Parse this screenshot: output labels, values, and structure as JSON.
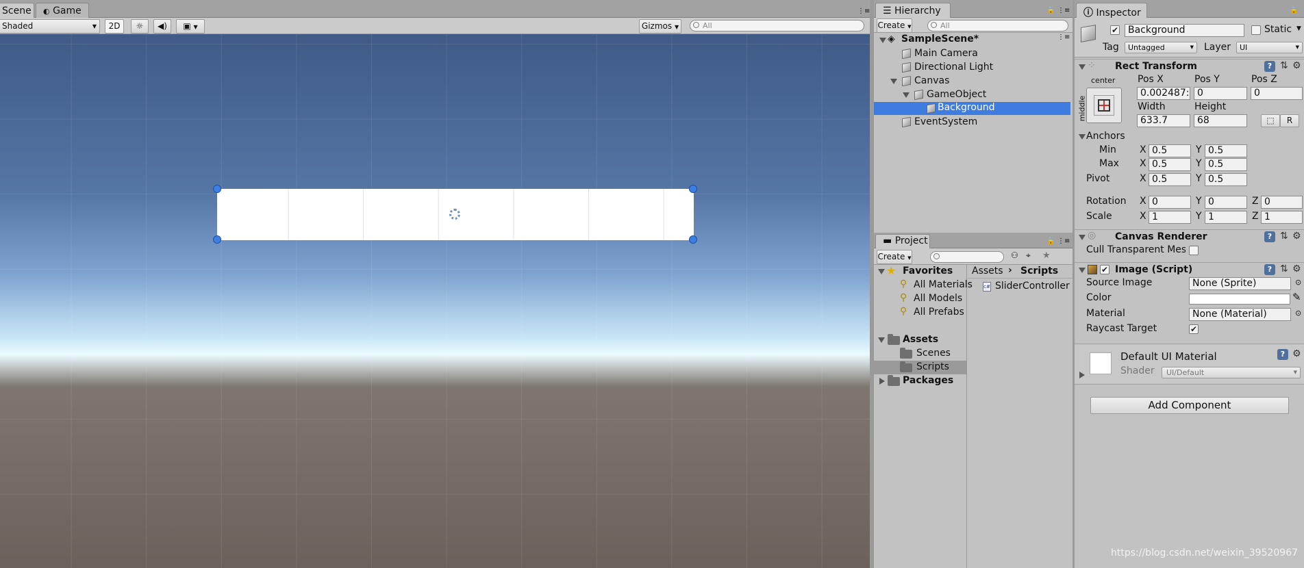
{
  "scene_view": {
    "tabs": [
      {
        "label": "Scene"
      },
      {
        "label": "Game"
      }
    ],
    "shading_mode": "Shaded",
    "mode_2d": "2D",
    "gizmos_label": "Gizmos",
    "search_placeholder": "All",
    "sky_color_top": "#3f5b86",
    "ground_color": "#6c625b"
  },
  "hierarchy": {
    "tab_label": "Hierarchy",
    "create_label": "Create",
    "search_placeholder": "All",
    "scene_name": "SampleScene*",
    "items": [
      {
        "label": "Main Camera"
      },
      {
        "label": "Directional Light"
      },
      {
        "label": "Canvas"
      },
      {
        "label": "GameObject"
      },
      {
        "label": "Background",
        "selected": true
      },
      {
        "label": "EventSystem"
      }
    ]
  },
  "project": {
    "tab_label": "Project",
    "create_label": "Create",
    "favorites_label": "Favorites",
    "favorites": [
      {
        "label": "All Materials"
      },
      {
        "label": "All Models"
      },
      {
        "label": "All Prefabs"
      }
    ],
    "assets_label": "Assets",
    "asset_folders": [
      {
        "label": "Scenes"
      },
      {
        "label": "Scripts",
        "selected": true
      }
    ],
    "packages_label": "Packages",
    "breadcrumb": [
      "Assets",
      "Scripts"
    ],
    "files": [
      {
        "label": "SliderController"
      }
    ]
  },
  "inspector": {
    "tab_label": "Inspector",
    "object_name": "Background",
    "static_label": "Static",
    "tag_label": "Tag",
    "tag_value": "Untagged",
    "layer_label": "Layer",
    "layer_value": "UI",
    "rect_transform": {
      "title": "Rect Transform",
      "anchor_h": "center",
      "anchor_v": "middle",
      "pos_x_label": "Pos X",
      "pos_x": "0.002487:",
      "pos_y_label": "Pos Y",
      "pos_y": "0",
      "pos_z_label": "Pos Z",
      "pos_z": "0",
      "width_label": "Width",
      "width": "633.7",
      "height_label": "Height",
      "height": "68",
      "r_button": "R",
      "anchors_label": "Anchors",
      "min_label": "Min",
      "min_x": "0.5",
      "min_y": "0.5",
      "max_label": "Max",
      "max_x": "0.5",
      "max_y": "0.5",
      "pivot_label": "Pivot",
      "pivot_x": "0.5",
      "pivot_y": "0.5",
      "rotation_label": "Rotation",
      "rot_x": "0",
      "rot_y": "0",
      "rot_z": "0",
      "scale_label": "Scale",
      "scale_x": "1",
      "scale_y": "1",
      "scale_z": "1",
      "x": "X",
      "y": "Y",
      "z": "Z"
    },
    "canvas_renderer": {
      "title": "Canvas Renderer",
      "cull_label": "Cull Transparent Mes"
    },
    "image_script": {
      "title": "Image (Script)",
      "source_image_label": "Source Image",
      "source_image_value": "None (Sprite)",
      "color_label": "Color",
      "color_value": "#ffffff",
      "material_label": "Material",
      "material_value": "None (Material)",
      "raycast_label": "Raycast Target"
    },
    "material": {
      "name": "Default UI Material",
      "shader_label": "Shader",
      "shader_value": "UI/Default"
    },
    "add_component": "Add Component"
  },
  "watermark": "https://blog.csdn.net/weixin_39520967"
}
